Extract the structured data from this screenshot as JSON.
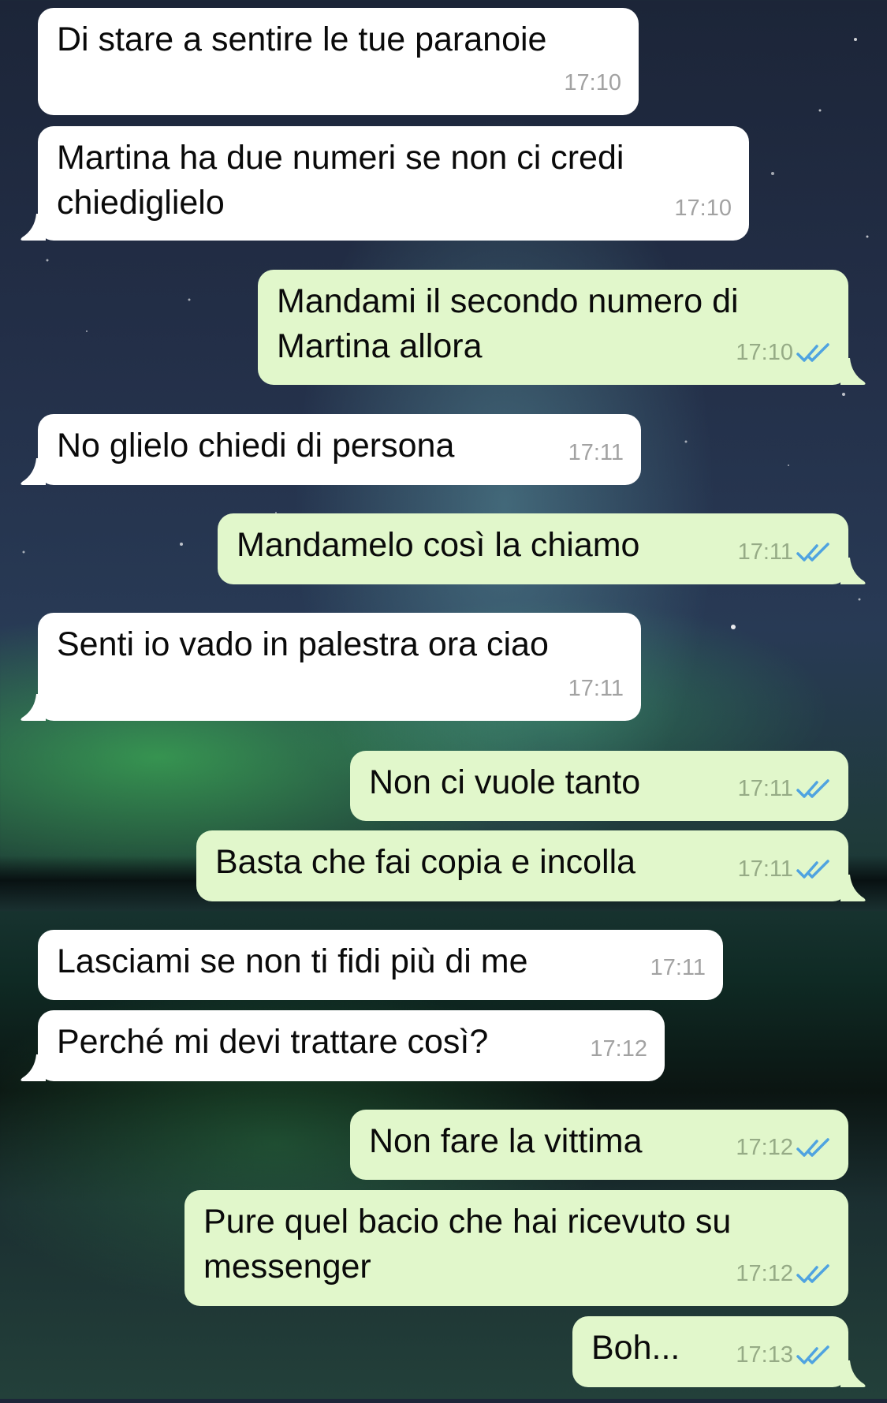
{
  "chat": {
    "messages": [
      {
        "dir": "in",
        "text": "Di stare a sentire le tue paranoie",
        "time": "17:10"
      },
      {
        "dir": "in",
        "text": "Martina ha due numeri se non ci credi chiediglielo",
        "time": "17:10"
      },
      {
        "dir": "out",
        "text": "Mandami il secondo numero di Martina allora",
        "time": "17:10",
        "status": "read-double-check"
      },
      {
        "dir": "in",
        "text": "No glielo chiedi di persona",
        "time": "17:11"
      },
      {
        "dir": "out",
        "text": "Mandamelo così la chiamo",
        "time": "17:11",
        "status": "read-double-check"
      },
      {
        "dir": "in",
        "text": "Senti io vado in palestra ora ciao",
        "time": "17:11"
      },
      {
        "dir": "out",
        "text": "Non ci vuole tanto",
        "time": "17:11",
        "status": "read-double-check"
      },
      {
        "dir": "out",
        "text": "Basta che fai copia e incolla",
        "time": "17:11",
        "status": "read-double-check"
      },
      {
        "dir": "in",
        "text": "Lasciami se non ti fidi più di me",
        "time": "17:11"
      },
      {
        "dir": "in",
        "text": "Perché mi devi trattare così?",
        "time": "17:12"
      },
      {
        "dir": "out",
        "text": "Non fare la vittima",
        "time": "17:12",
        "status": "read-double-check"
      },
      {
        "dir": "out",
        "text": "Pure quel bacio che hai ricevuto su messenger",
        "time": "17:12",
        "status": "read-double-check"
      },
      {
        "dir": "out",
        "text": "Boh...",
        "time": "17:13",
        "status": "read-double-check"
      }
    ]
  },
  "colors": {
    "incoming_bubble": "#ffffff",
    "outgoing_bubble": "#e1f7cb",
    "read_check": "#4fa3e0",
    "timestamp_in": "#a2a2a2",
    "timestamp_out": "#96ab86"
  },
  "icons": {
    "read_status": "double-check-icon"
  },
  "background": "aurora-night-sky-wallpaper"
}
